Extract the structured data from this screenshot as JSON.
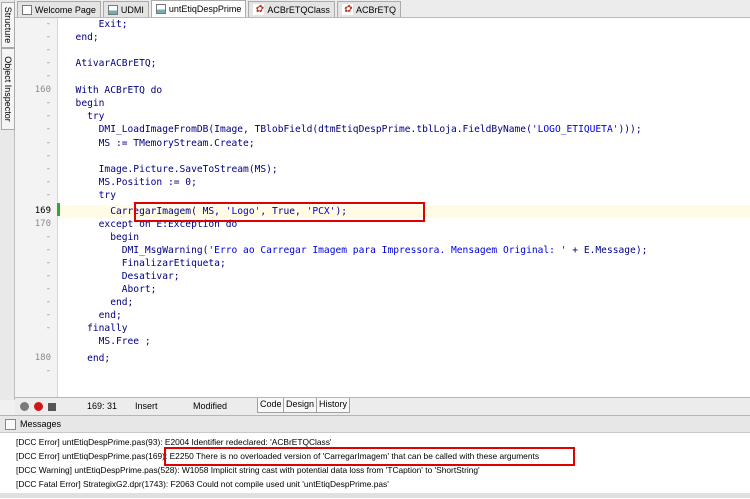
{
  "side_tabs": [
    "Structure",
    "Object Inspector"
  ],
  "tabs": [
    {
      "label": "Welcome Page",
      "icon": "page-icon"
    },
    {
      "label": "UDMI",
      "icon": "unit-icon"
    },
    {
      "label": "untEtiqDespPrime",
      "icon": "unit-icon"
    },
    {
      "label": "ACBrETQClass",
      "icon": "class-icon"
    },
    {
      "label": "ACBrETQ",
      "icon": "class-icon"
    }
  ],
  "gutter": [
    "-",
    "-",
    "-",
    "-",
    "-",
    "160",
    "-",
    "-",
    "-",
    "-",
    "-",
    "-",
    "-",
    "-",
    "-",
    "169",
    "170",
    "-",
    "-",
    "-",
    "-",
    "-",
    "-",
    "-",
    "-",
    "-",
    "180",
    "-"
  ],
  "code_lines": [
    "      Exit;",
    "  end;",
    "",
    "  AtivarACBrETQ;",
    "",
    "  With ACBrETQ do",
    "  begin",
    "    try",
    "      DMI_LoadImageFromDB(Image, TBlobField(dtmEtiqDespPrime.tblLoja.FieldByName('LOGO_ETIQUETA')));",
    "      MS := TMemoryStream.Create;",
    "",
    "      Image.Picture.SaveToStream(MS);",
    "      MS.Position := 0;",
    "      try",
    "        CarregarImagem( MS, 'Logo', True, 'PCX');",
    "      except on E:Exception do",
    "        begin",
    "          DMI_MsgWarning('Erro ao Carregar Imagem para Impressora. Mensagem Original: ' + E.Message);",
    "          FinalizarEtiqueta;",
    "          Desativar;",
    "          Abort;",
    "        end;",
    "      end;",
    "    finally",
    "      MS.Free ;",
    "    end;"
  ],
  "status": {
    "position": "169: 31",
    "mode": "Insert",
    "state": "Modified",
    "tabs": [
      "Code",
      "Design",
      "History"
    ]
  },
  "messages": {
    "title": "Messages",
    "items": [
      "[DCC Error] untEtiqDespPrime.pas(93): E2004 Identifier redeclared: 'ACBrETQClass'",
      "[DCC Error] untEtiqDespPrime.pas(169): E2250 There is no overloaded version of 'CarregarImagem' that can be called with these arguments",
      "[DCC Warning] untEtiqDespPrime.pas(528): W1058 Implicit string cast with potential data loss from 'TCaption' to 'ShortString'",
      "[DCC Fatal Error] StrategixG2.dpr(1743): F2063 Could not compile used unit 'untEtiqDespPrime.pas'"
    ]
  },
  "colors": {
    "highlight": "#e00000",
    "keyword": "#000080",
    "string": "#0000e0",
    "changebar": "#2fa82f"
  }
}
